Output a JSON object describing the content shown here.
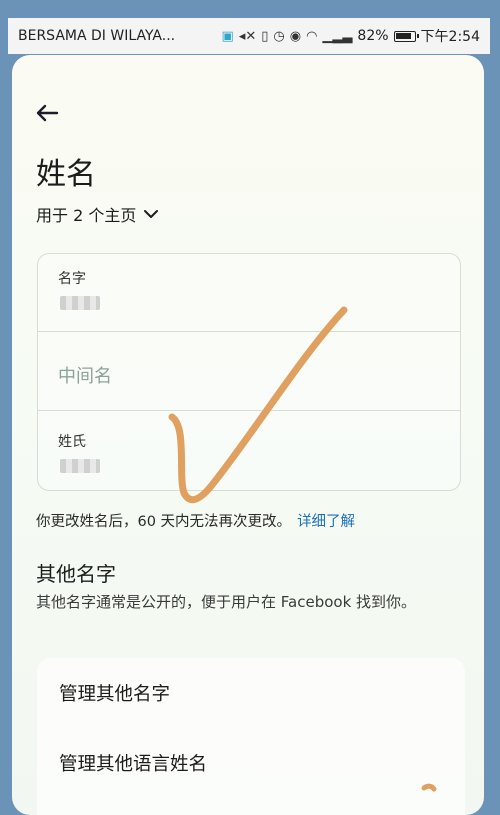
{
  "status_bar": {
    "left_text": "BERSAMA DI WILAYA...",
    "battery": "82%",
    "time": "下午2:54"
  },
  "header": {
    "title": "姓名",
    "used_for": "用于 2 个主页"
  },
  "name_fields": {
    "first_name_label": "名字",
    "middle_name_placeholder": "中间名",
    "last_name_label": "姓氏"
  },
  "notice": {
    "text": "你更改姓名后，60 天内无法再次更改。",
    "link": "详细了解"
  },
  "other_names": {
    "title": "其他名字",
    "description": "其他名字通常是公开的，便于用户在 Facebook 找到你。",
    "items": [
      "管理其他名字",
      "管理其他语言姓名"
    ]
  },
  "colors": {
    "background": "#6b93b8",
    "link": "#1b6fbf",
    "annotation_check": "#e0a060"
  }
}
